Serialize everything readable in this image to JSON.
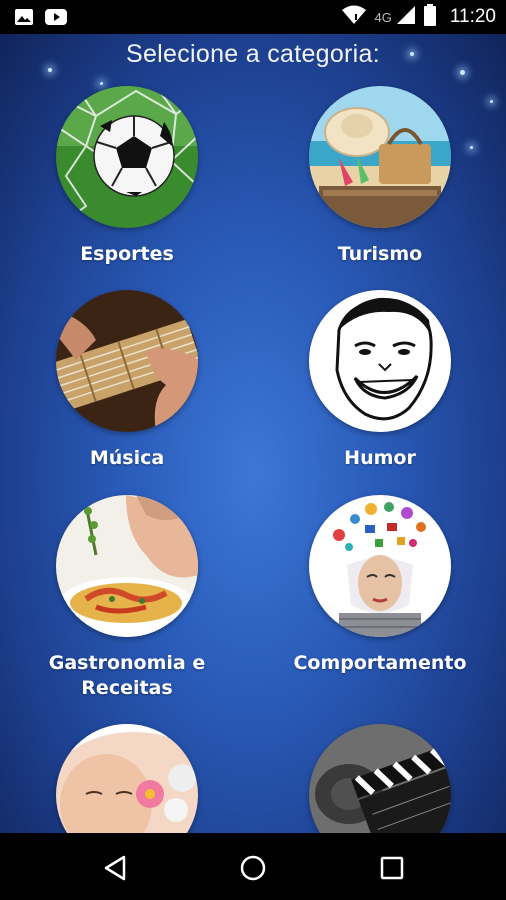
{
  "status_bar": {
    "time": "11:20",
    "network": "4G",
    "icons": [
      "image-notification-icon",
      "youtube-notification-icon",
      "wifi-icon",
      "signal-icon",
      "battery-icon"
    ]
  },
  "page": {
    "title": "Selecione a categoria:"
  },
  "categories": [
    {
      "label": "Esportes",
      "icon": "soccer-ball-image"
    },
    {
      "label": "Turismo",
      "icon": "beach-bag-image"
    },
    {
      "label": "Música",
      "icon": "guitar-image"
    },
    {
      "label": "Humor",
      "icon": "meme-face-image"
    },
    {
      "label": "Gastronomia e Receitas",
      "icon": "food-dish-image"
    },
    {
      "label": "Comportamento",
      "icon": "thinking-woman-image"
    },
    {
      "label": "",
      "icon": "spa-woman-image"
    },
    {
      "label": "",
      "icon": "clapperboard-image"
    }
  ],
  "nav_bar": {
    "buttons": [
      "back-button",
      "home-button",
      "recents-button"
    ]
  },
  "colors": {
    "background_center": "#3d77d6",
    "background_edge": "#10245a",
    "text": "#ffffff",
    "bars": "#000000"
  }
}
